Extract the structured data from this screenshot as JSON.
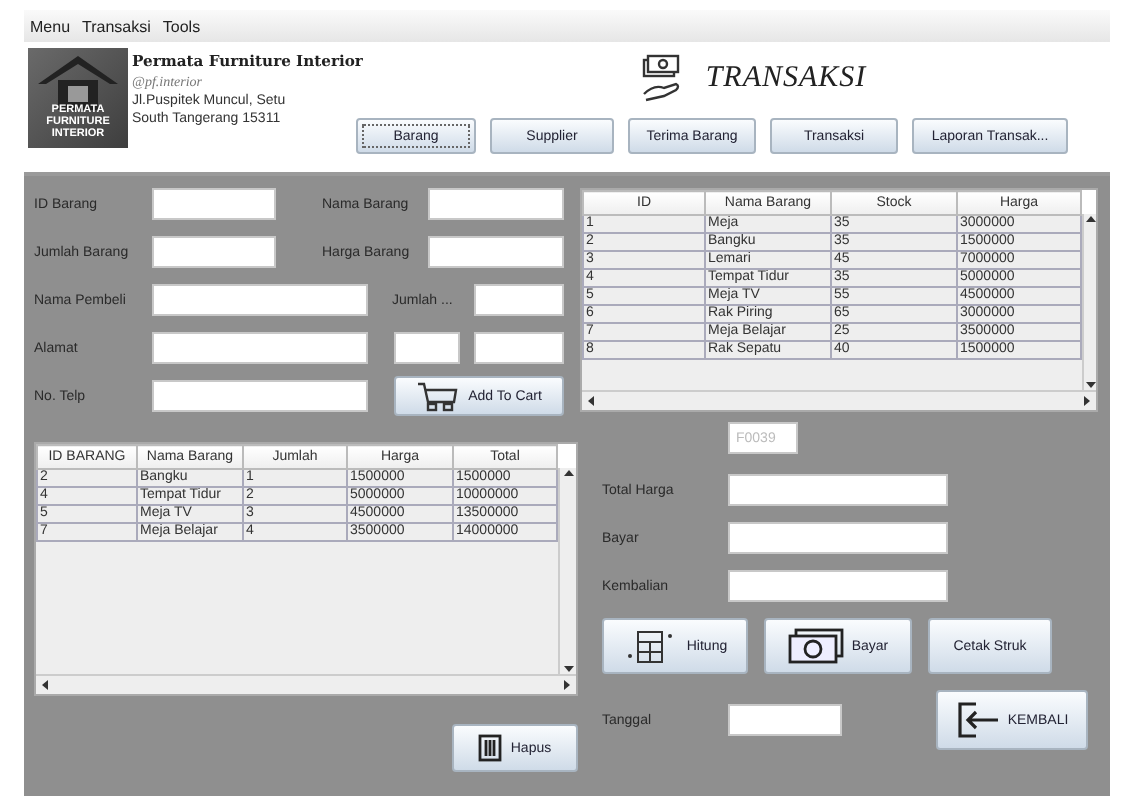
{
  "menu": [
    "Menu",
    "Transaksi",
    "Tools"
  ],
  "header": {
    "logo_lines": [
      "PERMATA",
      "FURNITURE",
      "INTERIOR"
    ],
    "company": "Permata Furniture Interior",
    "handle": "@pf.interior",
    "address_lines": [
      "Jl.Puspitek Muncul, Setu",
      "South Tangerang 15311"
    ],
    "title": "TRANSAKSI",
    "nav_buttons": [
      {
        "label": "Barang",
        "focused": true
      },
      {
        "label": "Supplier",
        "focused": false
      },
      {
        "label": "Terima Barang",
        "focused": false
      },
      {
        "label": "Transaksi",
        "focused": false
      },
      {
        "label": "Laporan Transak...",
        "focused": false
      }
    ]
  },
  "item_form": {
    "id_label": "ID Barang",
    "name_label": "Nama Barang",
    "qty_label": "Jumlah Barang",
    "price_label": "Harga Barang",
    "buyer_label": "Nama Pembeli",
    "amount_label": "Jumlah ...",
    "address_label": "Alamat",
    "phone_label": "No. Telp",
    "add_button": "Add To Cart"
  },
  "stock_table": {
    "columns": [
      "ID",
      "Nama Barang",
      "Stock",
      "Harga"
    ],
    "rows": [
      [
        "1",
        "Meja",
        "35",
        "3000000"
      ],
      [
        "2",
        "Bangku",
        "35",
        "1500000"
      ],
      [
        "3",
        "Lemari",
        "45",
        "7000000"
      ],
      [
        "4",
        "Tempat Tidur",
        "35",
        "5000000"
      ],
      [
        "5",
        "Meja TV",
        "55",
        "4500000"
      ],
      [
        "6",
        "Rak Piring",
        "65",
        "3000000"
      ],
      [
        "7",
        "Meja Belajar",
        "25",
        "3500000"
      ],
      [
        "8",
        "Rak Sepatu",
        "40",
        "1500000"
      ]
    ]
  },
  "invoice_field": {
    "value": "F0039",
    "disabled": true
  },
  "cart_table": {
    "columns": [
      "ID BARANG",
      "Nama Barang",
      "Jumlah",
      "Harga",
      "Total"
    ],
    "rows": [
      [
        "2",
        "Bangku",
        "1",
        "1500000",
        "1500000"
      ],
      [
        "4",
        "Tempat Tidur",
        "2",
        "5000000",
        "10000000"
      ],
      [
        "5",
        "Meja TV",
        "3",
        "4500000",
        "13500000"
      ],
      [
        "7",
        "Meja Belajar",
        "4",
        "3500000",
        "14000000"
      ]
    ]
  },
  "delete_button": "Hapus",
  "payment": {
    "total_label": "Total Harga",
    "pay_label": "Bayar",
    "change_label": "Kembalian",
    "date_label": "Tanggal"
  },
  "action_buttons": [
    {
      "kind": "calculate",
      "label": "Hitung"
    },
    {
      "kind": "pay",
      "label": "Bayar"
    },
    {
      "kind": "print",
      "label": "Cetak Struk"
    }
  ],
  "back_button": "KEMBALI"
}
